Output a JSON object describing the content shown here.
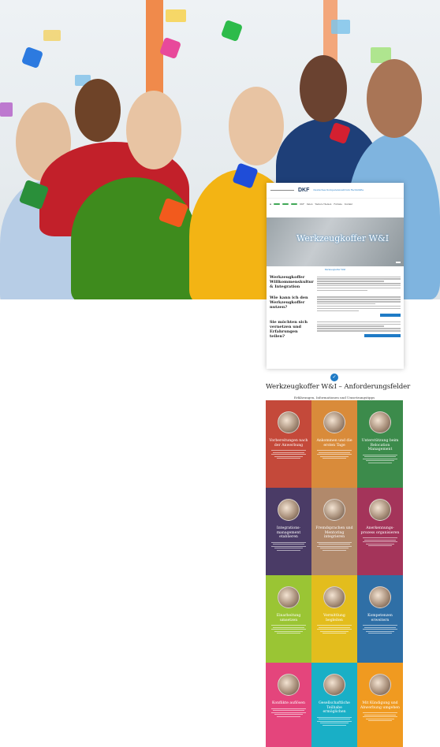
{
  "hero": {
    "alt": ""
  },
  "embedded_page": {
    "logo_text": "DKF",
    "logo_sub": "Deutsches Kompetenzzentrum Fachkräfte",
    "nav": {
      "buttons": [
        "",
        "",
        ""
      ],
      "links": [
        "DKF",
        "Daten",
        "Weitere Themen",
        "Formate",
        "Kontakt"
      ]
    },
    "hero_title": "Werkzeugkoffer W&I",
    "hero_button": "",
    "breadcrumb": "Werkzeugkoffer W&I",
    "sections": [
      {
        "heading": "Werkzeugkoffer Willkommenskultur & Integration"
      },
      {
        "heading": "Wie kann ich den Werkzeugkoffer nutzen?"
      },
      {
        "heading": "Sie möchten sich vernetzen und Erfahrungen teilen?"
      }
    ]
  },
  "requirements": {
    "icon": "check-icon",
    "title": "Werkzeugkoffer W&I – Anforderungsfelder",
    "subtitle": "Erklärungen, Informationen und Umsetzungstipps",
    "tiles": [
      {
        "title": "Vorbereitungen nach der Anwerbung",
        "color": "#c4493a"
      },
      {
        "title": "Ankommen und die ersten Tage",
        "color": "#d98b3a"
      },
      {
        "title": "Unterstützung beim Relocation Management",
        "color": "#3c8b4b"
      },
      {
        "title": "Integrations-management etablieren",
        "color": "#4a3b66"
      },
      {
        "title": "Fremdsprachen und Mentoring integrieren",
        "color": "#b1896b"
      },
      {
        "title": "Anerkennungs-prozess organisieren",
        "color": "#a4345a"
      },
      {
        "title": "Einarbeitung umsetzen",
        "color": "#9ac534"
      },
      {
        "title": "Vermittlung begleiten",
        "color": "#e3bd1d"
      },
      {
        "title": "Kompetenzen erweitern",
        "color": "#2f6fa6"
      },
      {
        "title": "Konflikte auflösen",
        "color": "#e4457c"
      },
      {
        "title": "Gesellschaftliche Teilhabe ermöglichen",
        "color": "#19afc6"
      },
      {
        "title": "Mit Kündigung und Abwerbung umgehen",
        "color": "#f09a20"
      }
    ]
  }
}
